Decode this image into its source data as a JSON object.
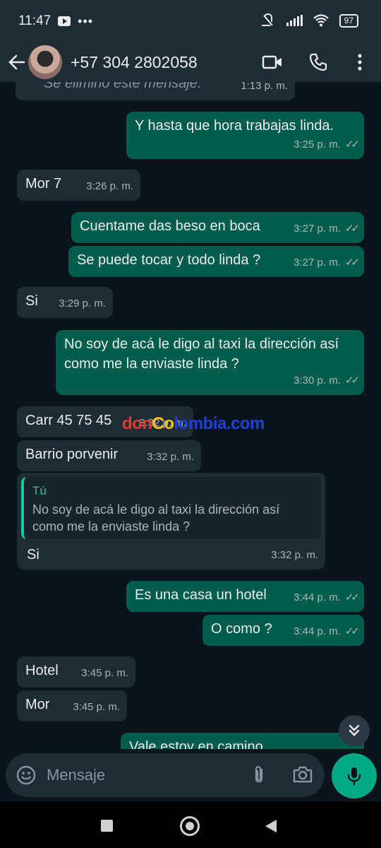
{
  "status_bar": {
    "time": "11:47",
    "battery": "97"
  },
  "header": {
    "contact": "+57 304 2802058"
  },
  "composer": {
    "placeholder": "Mensaje"
  },
  "watermark": {
    "part1": "don",
    "part2": "Co",
    "part3": "lombia.com"
  },
  "messages": [
    {
      "dir": "in",
      "text": "Se eliminó este mensaje.",
      "time": "1:13 p. m."
    },
    {
      "dir": "out",
      "text": "Y hasta que hora trabajas linda.",
      "time": "3:25 p. m."
    },
    {
      "dir": "in",
      "text": "Mor 7",
      "time": "3:26 p. m."
    },
    {
      "dir": "out",
      "text": "Cuentame das beso en boca",
      "time": "3:27 p. m."
    },
    {
      "dir": "out",
      "text": "Se puede tocar y todo linda ?",
      "time": "3:27 p. m."
    },
    {
      "dir": "in",
      "text": "Si",
      "time": "3:29 p. m."
    },
    {
      "dir": "out",
      "text": "No soy de acá le digo al taxi la dirección así como me la enviaste linda ?",
      "time": "3:30 p. m."
    },
    {
      "dir": "in",
      "text": "Carr 45 75 45",
      "time": "3:32 p. m."
    },
    {
      "dir": "in",
      "text": "Barrio porvenir",
      "time": "3:32 p. m."
    },
    {
      "dir": "in",
      "text": "Si",
      "time": "3:32 p. m.",
      "quote": {
        "author": "Tú",
        "text": "No soy de acá le digo al taxi la dirección así como me la enviaste linda ?"
      }
    },
    {
      "dir": "out",
      "text": "Es una casa un hotel",
      "time": "3:44 p. m."
    },
    {
      "dir": "out",
      "text": "O como ?",
      "time": "3:44 p. m."
    },
    {
      "dir": "in",
      "text": "Hotel",
      "time": "3:45 p. m."
    },
    {
      "dir": "in",
      "text": "Mor",
      "time": "3:45 p. m."
    },
    {
      "dir": "out",
      "text": "Vale estoy en camino",
      "time": ""
    }
  ],
  "icons": {
    "back": "arrow-left-icon",
    "video": "video-call-icon",
    "call": "phone-icon",
    "menu": "more-vertical-icon",
    "emoji": "emoji-icon",
    "attach": "paperclip-icon",
    "camera": "camera-icon",
    "mic": "microphone-icon",
    "scroll": "double-chevron-down-icon"
  },
  "colors": {
    "incoming": "#1f2c34",
    "outgoing": "#005c4b",
    "accent": "#00a884",
    "quote_author": "#06cf9c"
  }
}
